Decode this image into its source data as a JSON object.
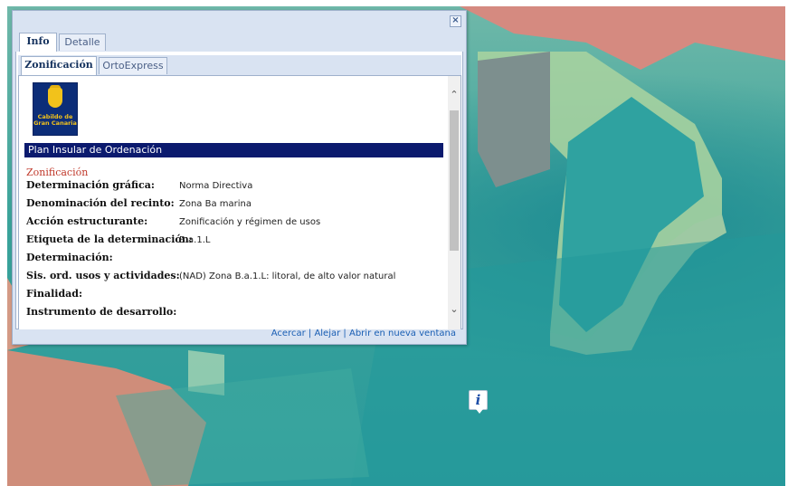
{
  "popup": {
    "close_symbol": "×",
    "outer_tabs": [
      {
        "label": "Info",
        "active": true
      },
      {
        "label": "Detalle",
        "active": false
      }
    ],
    "inner_tabs": [
      {
        "label": "Zonificación",
        "active": true
      },
      {
        "label": "OrtoExpress",
        "active": false
      }
    ],
    "logo": {
      "text_line1": "Cabildo de",
      "text_line2": "Gran Canaria"
    },
    "section_title": "Plan Insular de Ordenación",
    "zoning_heading": "Zonificación",
    "rows": [
      {
        "label": "Determinación gráfica:",
        "value": "Norma Directiva"
      },
      {
        "label": "Denominación del recinto:",
        "value": "Zona Ba marina"
      },
      {
        "label": "Acción estructurante:",
        "value": "Zonificación y régimen de usos"
      },
      {
        "label": "Etiqueta de la determinación:",
        "value": "B.a.1.L"
      },
      {
        "label": "Determinación:",
        "value": ""
      },
      {
        "label": "Sis. ord. usos y actividades:",
        "value": "(NAD) Zona B.a.1.L: litoral, de alto valor natural"
      },
      {
        "label": "Finalidad:",
        "value": ""
      },
      {
        "label": "Instrumento de desarrollo:",
        "value": ""
      }
    ],
    "footer": {
      "zoom_in": "Acercar",
      "zoom_out": "Alejar",
      "open_new": "Abrir en nueva ventana",
      "separator": "|"
    }
  },
  "map": {
    "info_marker": "i",
    "colors": {
      "sea": "#2a9a9c",
      "zone_red": "#d9847a",
      "zone_green": "#9ccf9b",
      "popup_header": "#0b1a6e"
    }
  }
}
